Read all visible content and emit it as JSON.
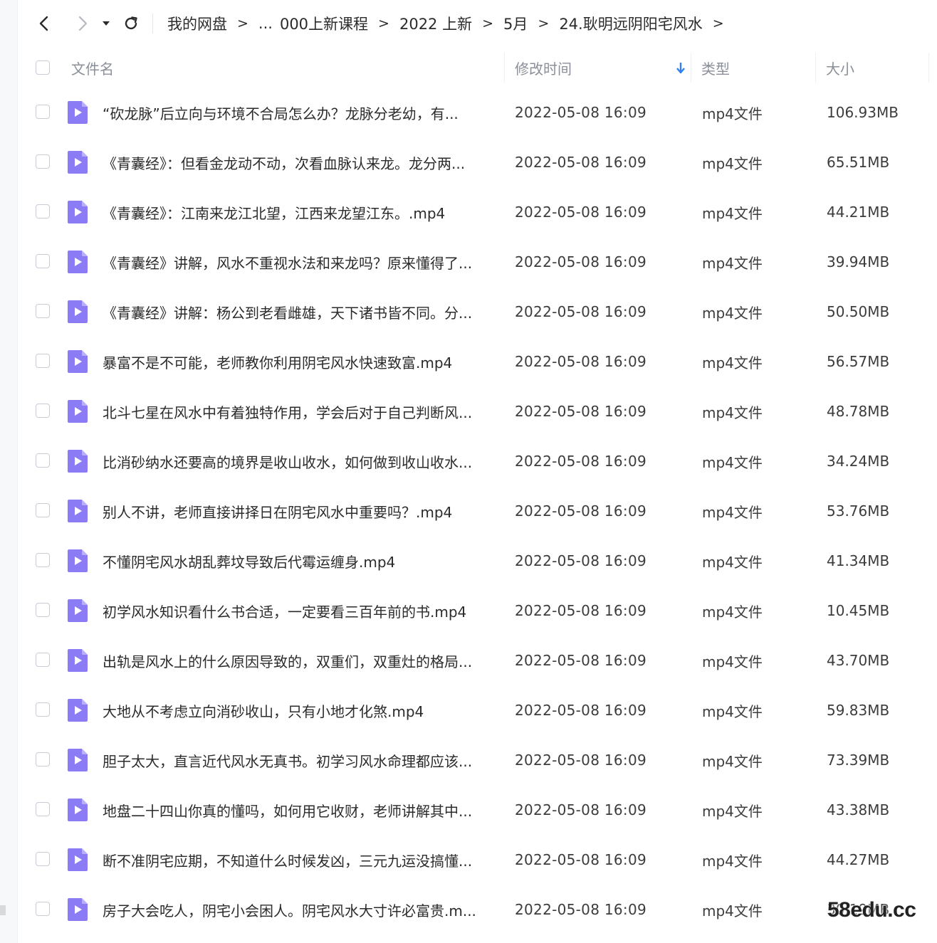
{
  "breadcrumb": {
    "items": [
      "我的网盘",
      "...",
      "000上新课程",
      "2022 上新",
      "5月",
      "24.耿明远阴阳宅风水"
    ],
    "separator": ">"
  },
  "header": {
    "name": "文件名",
    "modified": "修改时间",
    "type": "类型",
    "size": "大小"
  },
  "files": [
    {
      "name": "“砍龙脉”后立向与环境不合局怎么办？龙脉分老幼，有...",
      "time": "2022-05-08 16:09",
      "type": "mp4文件",
      "size": "106.93MB"
    },
    {
      "name": "《青囊经》：但看金龙动不动，次看血脉认来龙。龙分两...",
      "time": "2022-05-08 16:09",
      "type": "mp4文件",
      "size": "65.51MB"
    },
    {
      "name": "《青囊经》：江南来龙江北望，江西来龙望江东。.mp4",
      "time": "2022-05-08 16:09",
      "type": "mp4文件",
      "size": "44.21MB"
    },
    {
      "name": "《青囊经》讲解，风水不重视水法和来龙吗？原来懂得了...",
      "time": "2022-05-08 16:09",
      "type": "mp4文件",
      "size": "39.94MB"
    },
    {
      "name": "《青囊经》讲解：杨公到老看雌雄，天下诸书皆不同。分...",
      "time": "2022-05-08 16:09",
      "type": "mp4文件",
      "size": "50.50MB"
    },
    {
      "name": "暴富不是不可能，老师教你利用阴宅风水快速致富.mp4",
      "time": "2022-05-08 16:09",
      "type": "mp4文件",
      "size": "56.57MB"
    },
    {
      "name": "北斗七星在风水中有着独特作用，学会后对于自己判断风...",
      "time": "2022-05-08 16:09",
      "type": "mp4文件",
      "size": "48.78MB"
    },
    {
      "name": "比消砂纳水还要高的境界是收山收水，如何做到收山收水...",
      "time": "2022-05-08 16:09",
      "type": "mp4文件",
      "size": "34.24MB"
    },
    {
      "name": "别人不讲，老师直接讲择日在阴宅风水中重要吗？.mp4",
      "time": "2022-05-08 16:09",
      "type": "mp4文件",
      "size": "53.76MB"
    },
    {
      "name": "不懂阴宅风水胡乱葬坟导致后代霉运缠身.mp4",
      "time": "2022-05-08 16:09",
      "type": "mp4文件",
      "size": "41.34MB"
    },
    {
      "name": "初学风水知识看什么书合适，一定要看三百年前的书.mp4",
      "time": "2022-05-08 16:09",
      "type": "mp4文件",
      "size": "10.45MB"
    },
    {
      "name": "出轨是风水上的什么原因导致的，双重们，双重灶的格局...",
      "time": "2022-05-08 16:09",
      "type": "mp4文件",
      "size": "43.70MB"
    },
    {
      "name": "大地从不考虑立向消砂收山，只有小地才化煞.mp4",
      "time": "2022-05-08 16:09",
      "type": "mp4文件",
      "size": "59.83MB"
    },
    {
      "name": "胆子太大，直言近代风水无真书。初学习风水命理都应该...",
      "time": "2022-05-08 16:09",
      "type": "mp4文件",
      "size": "73.39MB"
    },
    {
      "name": "地盘二十四山你真的懂吗，如何用它收财，老师讲解其中...",
      "time": "2022-05-08 16:09",
      "type": "mp4文件",
      "size": "43.38MB"
    },
    {
      "name": "断不准阴宅应期，不知道什么时候发凶，三元九运没搞懂...",
      "time": "2022-05-08 16:09",
      "type": "mp4文件",
      "size": "44.27MB"
    },
    {
      "name": "房子大会吃人，阴宅小会困人。阴宅风水大寸许必富贵.m...",
      "time": "2022-05-08 16:09",
      "type": "mp4文件",
      "size": "30.19MB"
    }
  ],
  "watermark": "58edu.cc",
  "colors": {
    "icon": "#8b7cf6",
    "sort_arrow": "#2f7ff0"
  },
  "icons": [
    "back-icon",
    "forward-icon",
    "dropdown-icon",
    "refresh-icon",
    "sort-down-arrow-icon",
    "video-file-icon"
  ]
}
